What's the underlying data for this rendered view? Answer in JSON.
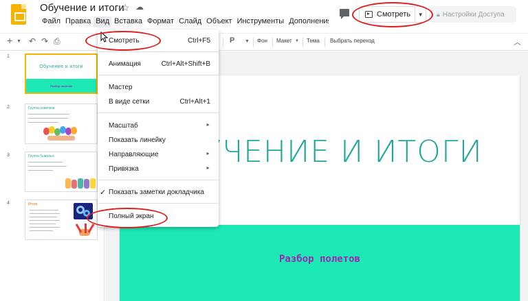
{
  "app": {
    "title": "Обучение и итоги",
    "icons": {
      "logo": "slides-logo",
      "star": "star-icon",
      "cloud": "cloud-saved-icon"
    }
  },
  "menubar": [
    "Файл",
    "Правка",
    "Вид",
    "Вставка",
    "Формат",
    "Слайд",
    "Объект",
    "Инструменты",
    "Дополнения"
  ],
  "header": {
    "present_label": "Смотреть",
    "share_label": "Настройки Доступа"
  },
  "toolbar": {
    "background": "Фон",
    "layout": "Макет",
    "theme": "Тема",
    "transition": "Выбрать переход"
  },
  "view_menu": {
    "items": [
      {
        "label": "Смотреть",
        "shortcut": "Ctrl+F5"
      },
      {
        "label": "Анимация",
        "shortcut": "Ctrl+Alt+Shift+B"
      },
      {
        "label": "Мастер",
        "shortcut": ""
      },
      {
        "label": "В виде сетки",
        "shortcut": "Ctrl+Alt+1"
      },
      {
        "label": "Масштаб",
        "submenu": true
      },
      {
        "label": "Показать линейку"
      },
      {
        "label": "Направляющие",
        "submenu": true
      },
      {
        "label": "Привязка",
        "submenu": true
      },
      {
        "label": "Показать заметки докладчика",
        "checked": true
      },
      {
        "label": "Полный экран"
      }
    ]
  },
  "filmstrip": {
    "slides": [
      {
        "num": "1",
        "title": "Обучение и итоги",
        "subtitle": "Разбор полетов"
      },
      {
        "num": "2",
        "title": "Группа новичков"
      },
      {
        "num": "3",
        "title": "Группа бывалых"
      },
      {
        "num": "4",
        "title": "Итоги"
      }
    ]
  },
  "slide": {
    "title": "ОБУЧЕНИЕ И ИТОГИ",
    "subtitle": "Разбор полетов"
  },
  "colors": {
    "accent_teal": "#26a69a",
    "band": "#1de9b6",
    "subtitle": "#9c27b0",
    "annotation": "#e01e1e",
    "logo": "#f4b400"
  }
}
